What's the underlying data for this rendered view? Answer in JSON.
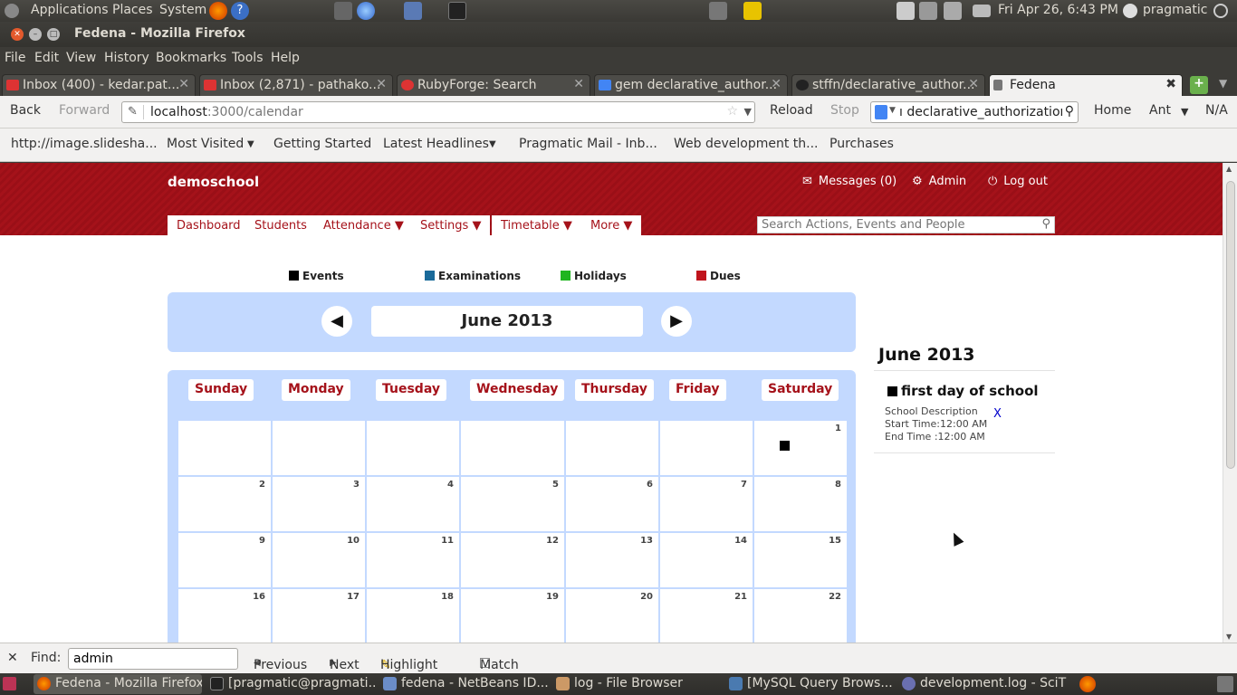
{
  "topbar": {
    "applications": "Applications",
    "places": "Places",
    "system": "System",
    "datetime": "Fri Apr 26,  6:43 PM",
    "user": "pragmatic"
  },
  "window": {
    "title": "Fedena - Mozilla Firefox"
  },
  "menu": [
    "File",
    "Edit",
    "View",
    "History",
    "Bookmarks",
    "Tools",
    "Help"
  ],
  "tabs": [
    {
      "label": "Inbox (400) - kedar.pat..."
    },
    {
      "label": "Inbox (2,871) - pathako..."
    },
    {
      "label": "RubyForge: Search"
    },
    {
      "label": "gem declarative_author..."
    },
    {
      "label": "stffn/declarative_author..."
    },
    {
      "label": "Fedena"
    }
  ],
  "navbar": {
    "back": "Back",
    "forward": "Forward",
    "url_host": "localhost",
    "url_rest": ":3000/calendar",
    "reload": "Reload",
    "stop": "Stop",
    "search_value": "ı declarative_authorizatior",
    "home": "Home",
    "ant": "Ant",
    "na": "N/A"
  },
  "bookmarks": [
    "http://image.slidesha...",
    "Most Visited",
    "Getting Started",
    "Latest Headlines",
    "Pragmatic Mail - Inb...",
    "Web development th...",
    "Purchases"
  ],
  "app": {
    "school": "demoschool",
    "messages": "Messages (0)",
    "admin": "Admin",
    "logout": "Log out",
    "nav": [
      "Dashboard",
      "Students",
      "Attendance ▼",
      "Settings ▼",
      "Timetable ▼",
      "More ▼"
    ],
    "search_placeholder": "Search Actions, Events and People",
    "colors": {
      "header": "#a5121a",
      "calendar_bg": "#c3d9ff"
    }
  },
  "legend": [
    {
      "label": "Events",
      "color": "#000000"
    },
    {
      "label": "Examinations",
      "color": "#1a6a9a"
    },
    {
      "label": "Holidays",
      "color": "#1fb51f"
    },
    {
      "label": "Dues",
      "color": "#c0141c"
    }
  ],
  "calendar": {
    "month_label": "June 2013",
    "prev": "◀",
    "next": "▶",
    "days": [
      "Sunday",
      "Monday",
      "Tuesday",
      "Wednesday",
      "Thursday",
      "Friday",
      "Saturday"
    ],
    "weeks": [
      [
        "",
        "",
        "",
        "",
        "",
        "",
        "1"
      ],
      [
        "2",
        "3",
        "4",
        "5",
        "6",
        "7",
        "8"
      ],
      [
        "9",
        "10",
        "11",
        "12",
        "13",
        "14",
        "15"
      ],
      [
        "16",
        "17",
        "18",
        "19",
        "20",
        "21",
        "22"
      ]
    ],
    "event_days": [
      "1"
    ]
  },
  "sidebar": {
    "month": "June 2013",
    "event_title": "first day of school",
    "description": "School Description",
    "start": "Start Time:12:00 AM",
    "end": "End Time :12:00 AM",
    "delete": "X"
  },
  "findbar": {
    "label": "Find:",
    "value": "admin",
    "previous": "Previous",
    "next": "Next",
    "highlight": "Highlight all",
    "matchcase": "Match case"
  },
  "taskbar": [
    {
      "label": "Fedena - Mozilla Firefox"
    },
    {
      "label": "[pragmatic@pragmati..."
    },
    {
      "label": "fedena - NetBeans ID..."
    },
    {
      "label": "log - File Browser"
    },
    {
      "label": "[MySQL Query Brows..."
    },
    {
      "label": "development.log - SciTE"
    }
  ]
}
